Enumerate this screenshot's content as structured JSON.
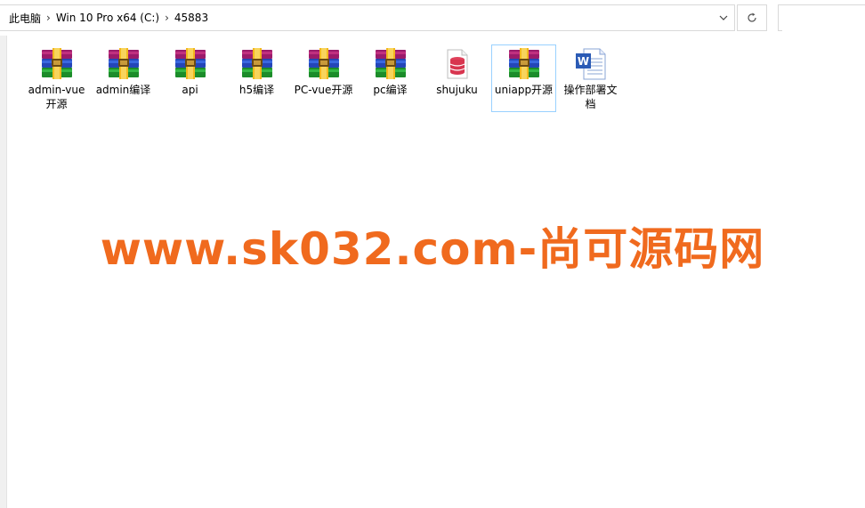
{
  "address_bar": {
    "crumbs": [
      "此电脑",
      "Win 10 Pro x64 (C:)",
      "45883"
    ],
    "dropdown_icon": "chevron-down-icon",
    "refresh_icon": "refresh-icon"
  },
  "search": {
    "placeholder": ""
  },
  "files": [
    {
      "name": "admin-vue开源",
      "type": "archive"
    },
    {
      "name": "admin编译",
      "type": "archive"
    },
    {
      "name": "api",
      "type": "archive"
    },
    {
      "name": "h5编译",
      "type": "archive"
    },
    {
      "name": "PC-vue开源",
      "type": "archive"
    },
    {
      "name": "pc编译",
      "type": "archive"
    },
    {
      "name": "shujuku",
      "type": "database"
    },
    {
      "name": "uniapp开源",
      "type": "archive",
      "selected": true
    },
    {
      "name": "操作部署文档",
      "type": "word"
    }
  ],
  "watermark": "www.sk032.com-尚可源码网",
  "colors": {
    "watermark": "#f06a1e",
    "selection_border": "#99d1ff"
  }
}
